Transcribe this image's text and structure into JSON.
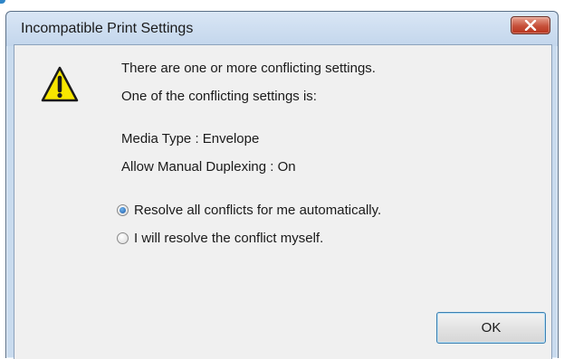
{
  "window": {
    "title": "Incompatible Print Settings"
  },
  "message": {
    "line1": "There are one or more conflicting settings.",
    "line2": "One of the conflicting settings is:",
    "setting1": "Media Type : Envelope",
    "setting2": "Allow Manual Duplexing : On"
  },
  "options": [
    {
      "label": "Resolve all conflicts for me automatically.",
      "checked": true
    },
    {
      "label": "I will resolve the conflict myself.",
      "checked": false
    }
  ],
  "buttons": {
    "ok_label": "OK"
  },
  "icons": {
    "warning": "warning-icon",
    "close": "close-icon"
  },
  "colors": {
    "close_button": "#c6503a",
    "warning_fill": "#f7e600",
    "ok_border": "#3c7fb1"
  }
}
